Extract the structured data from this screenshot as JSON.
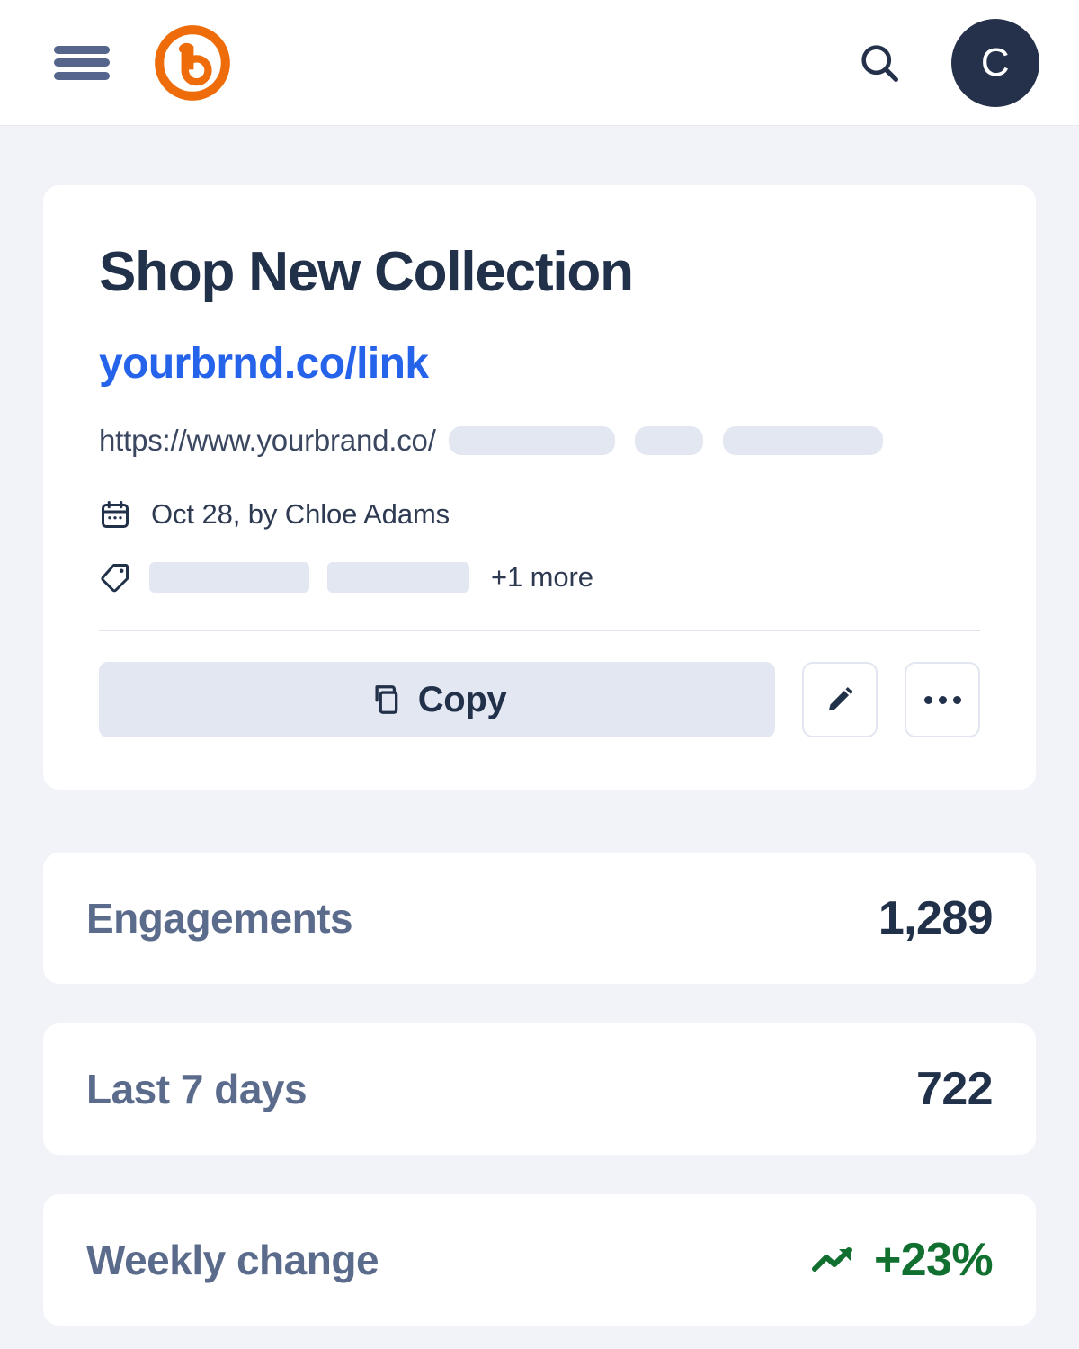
{
  "appbar": {
    "menu_icon": "hamburger-menu-icon",
    "logo_icon": "bitly-b-logo",
    "search_icon": "search-icon",
    "avatar_initial": "C"
  },
  "link_card": {
    "title": "Shop New Collection",
    "short_link": "yourbrnd.co/link",
    "long_url_prefix": "https://www.yourbrand.co/",
    "url_redaction_count": 3,
    "calendar_icon": "calendar-icon",
    "meta": "Oct 28,  by Chloe Adams",
    "tag_icon": "tag-icon",
    "tag_redaction_count": 2,
    "tags_more": "+1 more",
    "copy_icon": "copy-icon",
    "copy_label": "Copy",
    "edit_icon": "pencil-edit-icon",
    "more_icon": "more-horizontal-icon"
  },
  "stats": [
    {
      "label": "Engagements",
      "value": "1,289"
    },
    {
      "label": "Last 7 days",
      "value": "722"
    },
    {
      "label": "Weekly change",
      "value": "+23%",
      "trend_icon": "trending-up-icon"
    }
  ],
  "colors": {
    "brand_orange": "#ee6c0a",
    "link_blue": "#2563eb",
    "ink": "#22314a",
    "muted": "#5b6b8c",
    "positive_green": "#11702f",
    "skeleton": "#e3e7f1",
    "page_bg": "#f1f3f8"
  }
}
